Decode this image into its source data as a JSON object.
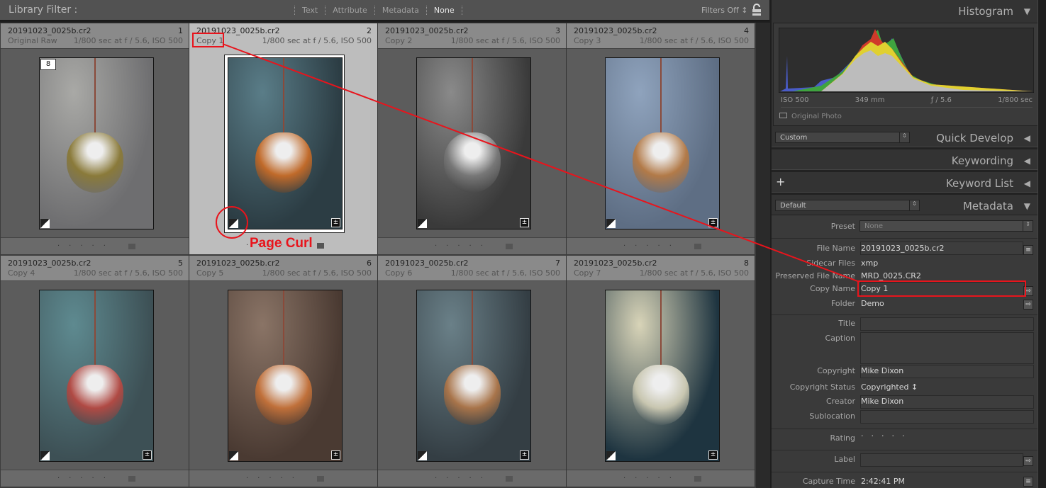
{
  "topbar": {
    "title": "Library Filter :",
    "filters": [
      "Text",
      "Attribute",
      "Metadata",
      "None"
    ],
    "selected_filter": "None",
    "filters_off": "Filters Off ↕"
  },
  "grid": {
    "cells": [
      {
        "file": "20191023_0025b.cr2",
        "index": "1",
        "copy": "Original Raw",
        "exposure": "1/800 sec at f / 5.6, ISO 500",
        "stack": "8",
        "tone": [
          "#a9a9a6",
          "#6e6e70",
          "#8a7a3a"
        ]
      },
      {
        "file": "20191023_0025b.cr2",
        "index": "2",
        "copy": "Copy 1",
        "exposure": "1/800 sec at f / 5.6, ISO 500",
        "tone": [
          "#5a7d88",
          "#2c3d44",
          "#c06a2a"
        ]
      },
      {
        "file": "20191023_0025b.cr2",
        "index": "3",
        "copy": "Copy 2",
        "exposure": "1/800 sec at f / 5.6, ISO 500",
        "tone": [
          "#8a8a8a",
          "#3a3a3a",
          "#777777"
        ]
      },
      {
        "file": "20191023_0025b.cr2",
        "index": "4",
        "copy": "Copy 3",
        "exposure": "1/800 sec at f / 5.6, ISO 500",
        "tone": [
          "#8fa3bd",
          "#5e6e84",
          "#b27a48"
        ]
      },
      {
        "file": "20191023_0025b.cr2",
        "index": "5",
        "copy": "Copy 4",
        "exposure": "1/800 sec at f / 5.6, ISO 500",
        "tone": [
          "#5e8a90",
          "#3d5055",
          "#b04a44"
        ]
      },
      {
        "file": "20191023_0025b.cr2",
        "index": "6",
        "copy": "Copy 5",
        "exposure": "1/800 sec at f / 5.6, ISO 500",
        "tone": [
          "#8a7466",
          "#4a3a32",
          "#c0703a"
        ]
      },
      {
        "file": "20191023_0025b.cr2",
        "index": "7",
        "copy": "Copy 6",
        "exposure": "1/800 sec at f / 5.6, ISO 500",
        "tone": [
          "#6a8088",
          "#343e44",
          "#a8744a"
        ]
      },
      {
        "file": "20191023_0025b.cr2",
        "index": "8",
        "copy": "Copy 7",
        "exposure": "1/800 sec at f / 5.6, ISO 500",
        "tone": [
          "#d8d4b8",
          "#1e3440",
          "#c8c6b0"
        ]
      }
    ],
    "selected_index": "2"
  },
  "annotation": {
    "label": "Page Curl",
    "color": "#e8141c"
  },
  "histogram": {
    "title": "Histogram",
    "iso": "ISO 500",
    "focal": "349 mm",
    "aperture": "ƒ / 5.6",
    "shutter": "1/800 sec",
    "original_photo": "Original Photo"
  },
  "panels": {
    "quick_develop": "Quick Develop",
    "quick_preset": "Custom",
    "keywording": "Keywording",
    "keyword_list": "Keyword List",
    "metadata": "Metadata",
    "metadata_preset": "Default"
  },
  "metadata": {
    "preset_label": "Preset",
    "preset": "None",
    "file_name_label": "File Name",
    "file_name": "20191023_0025b.cr2",
    "sidecar_label": "Sidecar Files",
    "sidecar": "xmp",
    "preserved_label": "Preserved File Name",
    "preserved": "MRD_0025.CR2",
    "copy_name_label": "Copy Name",
    "copy_name": "Copy 1",
    "folder_label": "Folder",
    "folder": "Demo",
    "title_label": "Title",
    "caption_label": "Caption",
    "copyright_label": "Copyright",
    "copyright": "Mike Dixon",
    "copyright_status_label": "Copyright Status",
    "copyright_status": "Copyrighted ↕",
    "creator_label": "Creator",
    "creator": "Mike Dixon",
    "sublocation_label": "Sublocation",
    "rating_label": "Rating",
    "rating": 0,
    "label_label": "Label",
    "capture_time_label": "Capture Time",
    "capture_time": "2:42:41 PM"
  }
}
